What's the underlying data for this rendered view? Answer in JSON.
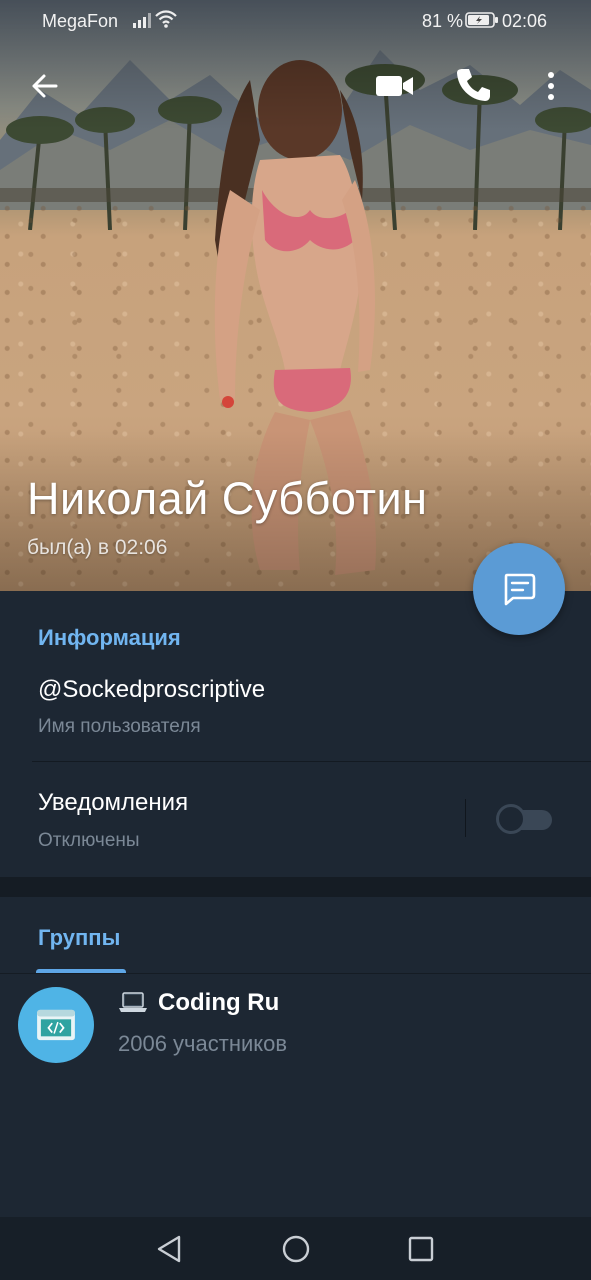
{
  "status_bar": {
    "carrier": "MegaFon",
    "battery_percent": "81 %",
    "time": "02:06"
  },
  "header": {
    "icons": [
      "back-arrow-icon",
      "video-camera-icon",
      "phone-icon",
      "more-vertical-icon"
    ]
  },
  "profile": {
    "name": "Николай Субботин",
    "last_seen": "был(а) в 02:06"
  },
  "info": {
    "section_title": "Информация",
    "username": "@Sockedproscriptive",
    "username_label": "Имя пользователя",
    "notifications_title": "Уведомления",
    "notifications_status": "Отключены",
    "notifications_enabled": false
  },
  "groups": {
    "tab_label": "Группы",
    "items": [
      {
        "icon": "laptop-icon",
        "name": "Coding Ru",
        "members": "2006 участников"
      }
    ]
  },
  "colors": {
    "background": "#1d2733",
    "accent": "#71b5f0",
    "fab": "#5b9bd5",
    "secondary_text": "#7b8896"
  }
}
